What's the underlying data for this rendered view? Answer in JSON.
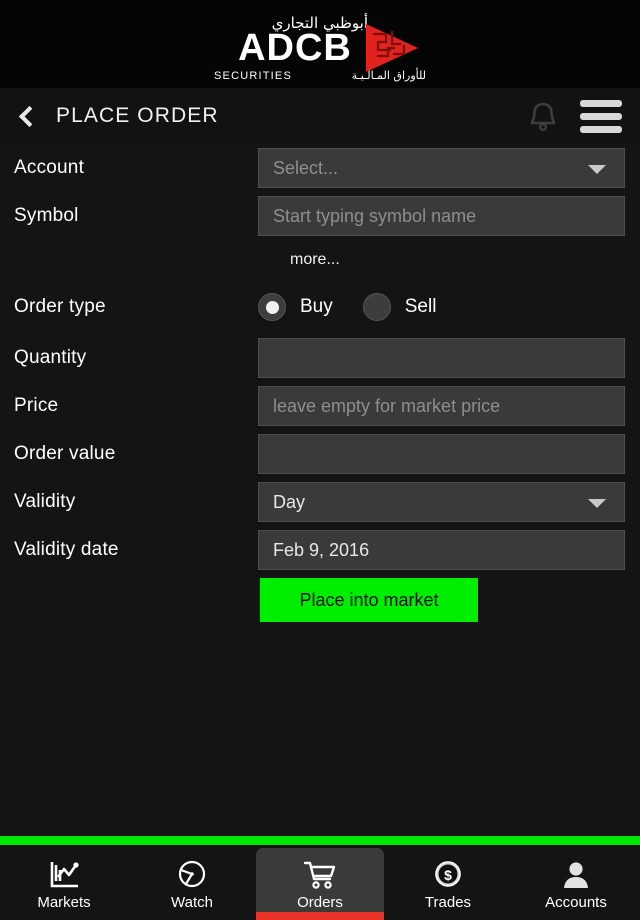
{
  "brand": {
    "arabic_top": "أبوظبي التجاري",
    "name": "ADCB",
    "sub_en": "SECURITIES",
    "sub_ar": "للأوراق المـالـيـة",
    "logo_color": "#e0231f"
  },
  "header": {
    "title": "PLACE ORDER",
    "back_icon": "chevron-left-icon",
    "bell_icon": "bell-icon",
    "menu_icon": "hamburger-menu-icon"
  },
  "form": {
    "account": {
      "label": "Account",
      "value": "",
      "placeholder": "Select...",
      "caret": "chevron-down-icon"
    },
    "symbol": {
      "label": "Symbol",
      "value": "",
      "placeholder": "Start typing symbol name"
    },
    "more_link": "more...",
    "order_type": {
      "label": "Order type",
      "selected": "Buy",
      "options": [
        "Buy",
        "Sell"
      ]
    },
    "quantity": {
      "label": "Quantity",
      "value": "",
      "placeholder": ""
    },
    "price": {
      "label": "Price",
      "value": "",
      "placeholder": "leave empty for market price"
    },
    "order_value": {
      "label": "Order value",
      "value": "",
      "placeholder": ""
    },
    "validity": {
      "label": "Validity",
      "value": "Day",
      "options": [
        "Day"
      ],
      "caret": "chevron-down-icon"
    },
    "validity_date": {
      "label": "Validity date",
      "value": "Feb 9, 2016"
    },
    "submit_label": "Place into market",
    "submit_color": "#00ee00"
  },
  "tabbar": {
    "active": "Orders",
    "accent_color": "#e8322a",
    "separator_color": "#00e800",
    "items": [
      {
        "label": "Markets",
        "icon": "chart-icon"
      },
      {
        "label": "Watch",
        "icon": "clock-icon"
      },
      {
        "label": "Orders",
        "icon": "shopping-cart-icon"
      },
      {
        "label": "Trades",
        "icon": "dollar-coin-icon"
      },
      {
        "label": "Accounts",
        "icon": "person-icon"
      }
    ]
  }
}
